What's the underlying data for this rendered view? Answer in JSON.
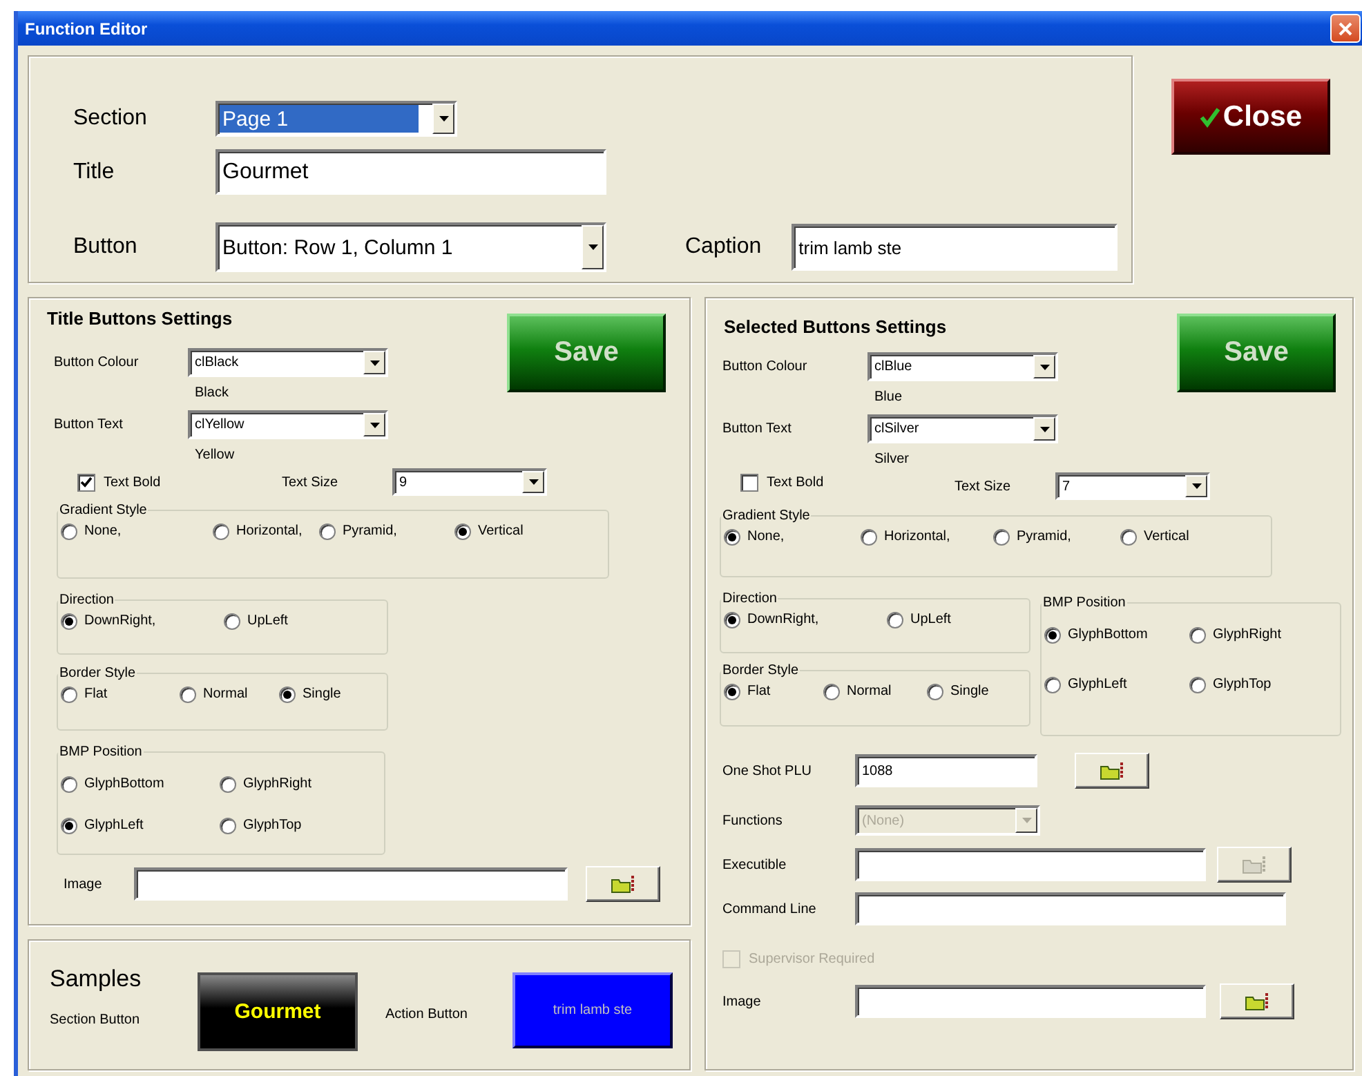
{
  "window": {
    "title": "Function Editor"
  },
  "header": {
    "section": {
      "label": "Section",
      "value": "Page 1",
      "focused": true
    },
    "title": {
      "label": "Title",
      "value": "Gourmet"
    },
    "button": {
      "label": "Button",
      "value": "Button:  Row 1, Column 1"
    },
    "caption": {
      "label": "Caption",
      "value": "trim lamb ste"
    },
    "close_button": "Close"
  },
  "settings": [
    {
      "heading": "Title Buttons Settings",
      "save_button": "Save",
      "button_colour": {
        "label": "Button Colour",
        "value": "clBlack",
        "note": "Black"
      },
      "button_text": {
        "label": "Button Text",
        "value": "clYellow",
        "note": "Yellow"
      },
      "text_bold": {
        "label": "Text Bold",
        "checked": true
      },
      "text_size": {
        "label": "Text Size",
        "value": "9"
      },
      "groups": [
        {
          "kind": "gradient",
          "label": "Gradient Style",
          "options": [
            {
              "label": "None,",
              "selected": false
            },
            {
              "label": "Horizontal,",
              "selected": false
            },
            {
              "label": "Pyramid,",
              "selected": false
            },
            {
              "label": "Vertical",
              "selected": true
            }
          ]
        },
        {
          "kind": "direction",
          "label": "Direction",
          "options": [
            {
              "label": "DownRight,",
              "selected": true
            },
            {
              "label": "UpLeft",
              "selected": false
            }
          ]
        },
        {
          "kind": "border",
          "label": "Border Style",
          "options": [
            {
              "label": "Flat",
              "selected": false
            },
            {
              "label": "Normal",
              "selected": false
            },
            {
              "label": "Single",
              "selected": true
            }
          ]
        },
        {
          "kind": "bmp",
          "label": "BMP Position",
          "options": [
            {
              "label": "GlyphBottom",
              "selected": false
            },
            {
              "label": "GlyphRight",
              "selected": false
            },
            {
              "label": "GlyphLeft",
              "selected": true
            },
            {
              "label": "GlyphTop",
              "selected": false
            }
          ]
        }
      ],
      "fields": [
        {
          "kind": "text_browse",
          "label": "Image",
          "browse_disabled": false
        }
      ]
    },
    {
      "heading": "Selected Buttons Settings",
      "save_button": "Save",
      "button_colour": {
        "label": "Button Colour",
        "value": "clBlue",
        "note": "Blue"
      },
      "button_text": {
        "label": "Button Text",
        "value": "clSilver",
        "note": "Silver"
      },
      "text_bold": {
        "label": "Text Bold",
        "checked": false
      },
      "text_size": {
        "label": "Text Size",
        "value": "7"
      },
      "groups": [
        {
          "kind": "gradient",
          "label": "Gradient Style",
          "options": [
            {
              "label": "None,",
              "selected": true
            },
            {
              "label": "Horizontal,",
              "selected": false
            },
            {
              "label": "Pyramid,",
              "selected": false
            },
            {
              "label": "Vertical",
              "selected": false
            }
          ]
        },
        {
          "kind": "direction",
          "label": "Direction",
          "options": [
            {
              "label": "DownRight,",
              "selected": true
            },
            {
              "label": "UpLeft",
              "selected": false
            }
          ]
        },
        {
          "kind": "border",
          "label": "Border Style",
          "options": [
            {
              "label": "Flat",
              "selected": true
            },
            {
              "label": "Normal",
              "selected": false
            },
            {
              "label": "Single",
              "selected": false
            }
          ]
        },
        {
          "kind": "bmp",
          "label": "BMP Position",
          "options": [
            {
              "label": "GlyphBottom",
              "selected": true
            },
            {
              "label": "GlyphRight",
              "selected": false
            },
            {
              "label": "GlyphLeft",
              "selected": false
            },
            {
              "label": "GlyphTop",
              "selected": false
            }
          ]
        }
      ],
      "fields": [
        {
          "kind": "text_browse",
          "label": "One Shot PLU",
          "value": "1088",
          "browse_disabled": false
        },
        {
          "kind": "dropdown",
          "label": "Functions",
          "value": "(None)",
          "disabled": true
        },
        {
          "kind": "text_browse",
          "label": "Executible",
          "browse_disabled": true
        },
        {
          "kind": "text",
          "label": "Command Line"
        },
        {
          "kind": "checkbox",
          "label": "Supervisor Required",
          "checked": false,
          "disabled": true
        },
        {
          "kind": "text_browse",
          "label": "Image",
          "browse_disabled": false
        }
      ]
    }
  ],
  "samples": {
    "heading": "Samples",
    "buttons": [
      {
        "label": "Section Button",
        "caption": {
          "text": "Gourmet",
          "color": "#ffff00"
        },
        "color": "#000000"
      },
      {
        "label": "Action Button",
        "caption": {
          "text": "trim lamb ste",
          "color": "#c0c0c0"
        },
        "color": "#0000ff"
      }
    ]
  }
}
